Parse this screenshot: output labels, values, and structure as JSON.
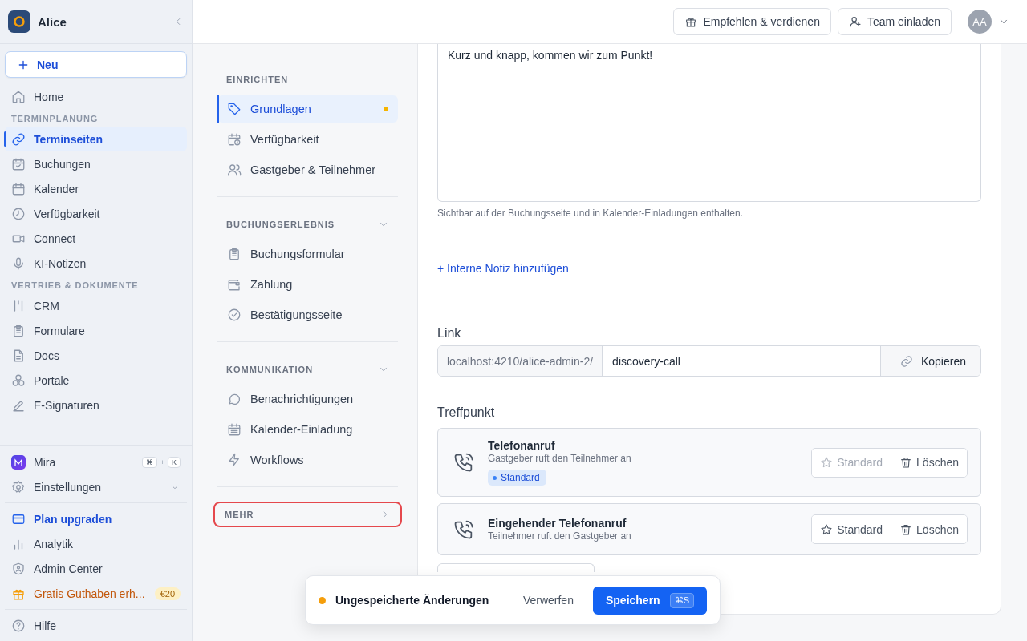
{
  "sidebar": {
    "workspace": "Alice",
    "new_button": "Neu",
    "items": [
      {
        "kind": "item",
        "label": "Home",
        "selected": false
      },
      {
        "kind": "header",
        "label": "TERMINPLANUNG"
      },
      {
        "kind": "item",
        "label": "Terminseiten",
        "selected": true
      },
      {
        "kind": "item",
        "label": "Buchungen",
        "selected": false
      },
      {
        "kind": "item",
        "label": "Kalender",
        "selected": false
      },
      {
        "kind": "item",
        "label": "Verfügbarkeit",
        "selected": false
      },
      {
        "kind": "item",
        "label": "Connect",
        "selected": false
      },
      {
        "kind": "item",
        "label": "KI-Notizen",
        "selected": false
      },
      {
        "kind": "header",
        "label": "VERTRIEB & DOKUMENTE"
      },
      {
        "kind": "item",
        "label": "CRM",
        "selected": false
      },
      {
        "kind": "item",
        "label": "Formulare",
        "selected": false
      },
      {
        "kind": "item",
        "label": "Docs",
        "selected": false
      },
      {
        "kind": "item",
        "label": "Portale",
        "selected": false
      },
      {
        "kind": "item",
        "label": "E-Signaturen",
        "selected": false
      }
    ],
    "footer_groups": [
      [
        {
          "kind": "assistant",
          "label": "Mira",
          "keys": [
            "⌘",
            "K"
          ],
          "joiner": "+"
        },
        {
          "kind": "expandable",
          "label": "Einstellungen",
          "expanded": false
        }
      ],
      [
        {
          "kind": "upgrade",
          "label": "Plan upgraden"
        },
        {
          "kind": "item",
          "label": "Analytik"
        },
        {
          "kind": "item",
          "label": "Admin Center"
        },
        {
          "kind": "promo",
          "label": "Gratis Guthaben erh...",
          "badge": "€20"
        }
      ],
      [
        {
          "kind": "item",
          "label": "Hilfe"
        }
      ]
    ]
  },
  "topbar": {
    "buttons": [
      "Empfehlen & verdienen",
      "Team einladen"
    ],
    "avatar": "AA"
  },
  "settings_nav": {
    "sections": [
      {
        "title": "EINRICHTEN",
        "items": [
          {
            "label": "Grundlagen",
            "selected": true,
            "modified": true
          },
          {
            "label": "Verfügbarkeit",
            "selected": false,
            "modified": false
          },
          {
            "label": "Gastgeber & Teilnehmer",
            "selected": false,
            "modified": false
          }
        ]
      },
      {
        "title": "BUCHUNGSERLEBNIS",
        "expanded": true,
        "highlighted": false,
        "items": [
          {
            "label": "Buchungsformular",
            "selected": false,
            "modified": false
          },
          {
            "label": "Zahlung",
            "selected": false,
            "modified": false
          },
          {
            "label": "Bestätigungsseite",
            "selected": false,
            "modified": false
          }
        ]
      },
      {
        "title": "KOMMUNIKATION",
        "expanded": true,
        "highlighted": false,
        "items": [
          {
            "label": "Benachrichtigungen",
            "selected": false,
            "modified": false
          },
          {
            "label": "Kalender-Einladung",
            "selected": false,
            "modified": false
          },
          {
            "label": "Workflows",
            "selected": false,
            "modified": false
          }
        ]
      },
      {
        "title": "MEHR",
        "expanded": false,
        "highlighted": true
      }
    ]
  },
  "form": {
    "description": "Kurz und knapp, kommen wir zum Punkt!",
    "description_hint": "Sichtbar auf der Buchungsseite und in Kalender-Einladungen enthalten.",
    "add_note_link": "+ Interne Notiz hinzufügen",
    "link": {
      "label": "Link",
      "prefix": "localhost:4210/alice-admin-2/",
      "slug": "discovery-call",
      "copy_button": "Kopieren"
    },
    "meeting_point": {
      "label": "Treffpunkt",
      "options": [
        {
          "title": "Telefonanruf",
          "subtitle": "Gastgeber ruft den Teilnehmer an",
          "default": true,
          "badge": "Standard",
          "default_button": "Standard",
          "delete_button": "Löschen"
        },
        {
          "title": "Eingehender Telefonanruf",
          "subtitle": "Teilnehmer ruft den Gastgeber an",
          "default": false,
          "default_button": "Standard",
          "delete_button": "Löschen"
        }
      ]
    }
  },
  "toast": {
    "status": "Ungespeicherte Änderungen",
    "discard": "Verwerfen",
    "save": "Speichern",
    "shortcut": "⌘S"
  }
}
